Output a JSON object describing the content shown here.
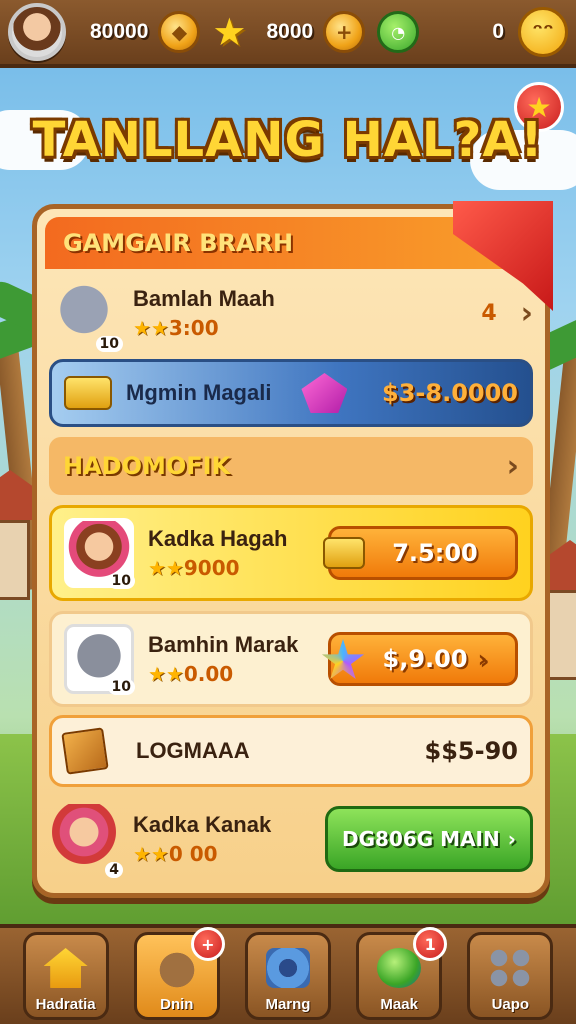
{
  "topbar": {
    "resource_1": "80000",
    "resource_2": "8000",
    "resource_3": "0",
    "icons": [
      "avatar",
      "gold-coin-icon",
      "star-icon",
      "plus-coin-icon",
      "chat-bubble-icon",
      "smiley-icon"
    ]
  },
  "title": "TANLLANG HAL?A!",
  "panel": {
    "header": "GAMGAIR BRARH",
    "row1": {
      "name": "Bamlah Maah",
      "level": "10",
      "sub": "3:00",
      "count": "4"
    },
    "row2": {
      "name": "Mgmin Magali",
      "price": "$3-8.0000"
    },
    "section": "HADOMOFIK",
    "card1": {
      "name": "Kadka Hagah",
      "level": "10",
      "sub": "9000",
      "button": "7.5:00"
    },
    "card2": {
      "name": "Bamhin Marak",
      "level": "10",
      "sub": "0.00",
      "button": "$,9.00"
    },
    "card3": {
      "name": "LOGMAAA",
      "price": "$$5-90"
    },
    "card4": {
      "name": "Kadka Kanak",
      "level": "4",
      "sub": "0 00",
      "button": "DG806G MAIN"
    }
  },
  "nav": [
    {
      "label": "Hadratia",
      "badge": ""
    },
    {
      "label": "Dnin",
      "badge": "+"
    },
    {
      "label": "Marng",
      "badge": ""
    },
    {
      "label": "Maak",
      "badge": "1"
    },
    {
      "label": "Uapo",
      "badge": ""
    }
  ],
  "colors": {
    "accent_orange": "#f07a0a",
    "accent_green": "#3aa526",
    "title_yellow": "#ffd635",
    "panel_border": "#a86426"
  }
}
